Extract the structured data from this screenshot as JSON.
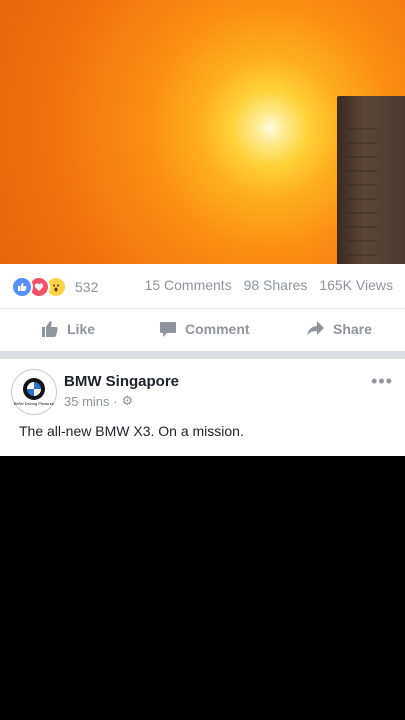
{
  "stats": {
    "reaction_count": "532",
    "comments": "15 Comments",
    "shares": "98 Shares",
    "views": "165K Views"
  },
  "actions": {
    "like_label": "Like",
    "comment_label": "Comment",
    "share_label": "Share"
  },
  "post": {
    "page_name": "BMW Singapore",
    "time": "35 mins ·",
    "text": "The all-new BMW X3. On a mission."
  },
  "avatar": {
    "tagline": "BMW Driving Pleasure"
  },
  "colors": {
    "sun_orange": "#f0700d",
    "like_blue": "#5890ff",
    "love_red": "#f25268",
    "wow_yellow": "#fbd24a",
    "muted_gray": "#90949c"
  }
}
